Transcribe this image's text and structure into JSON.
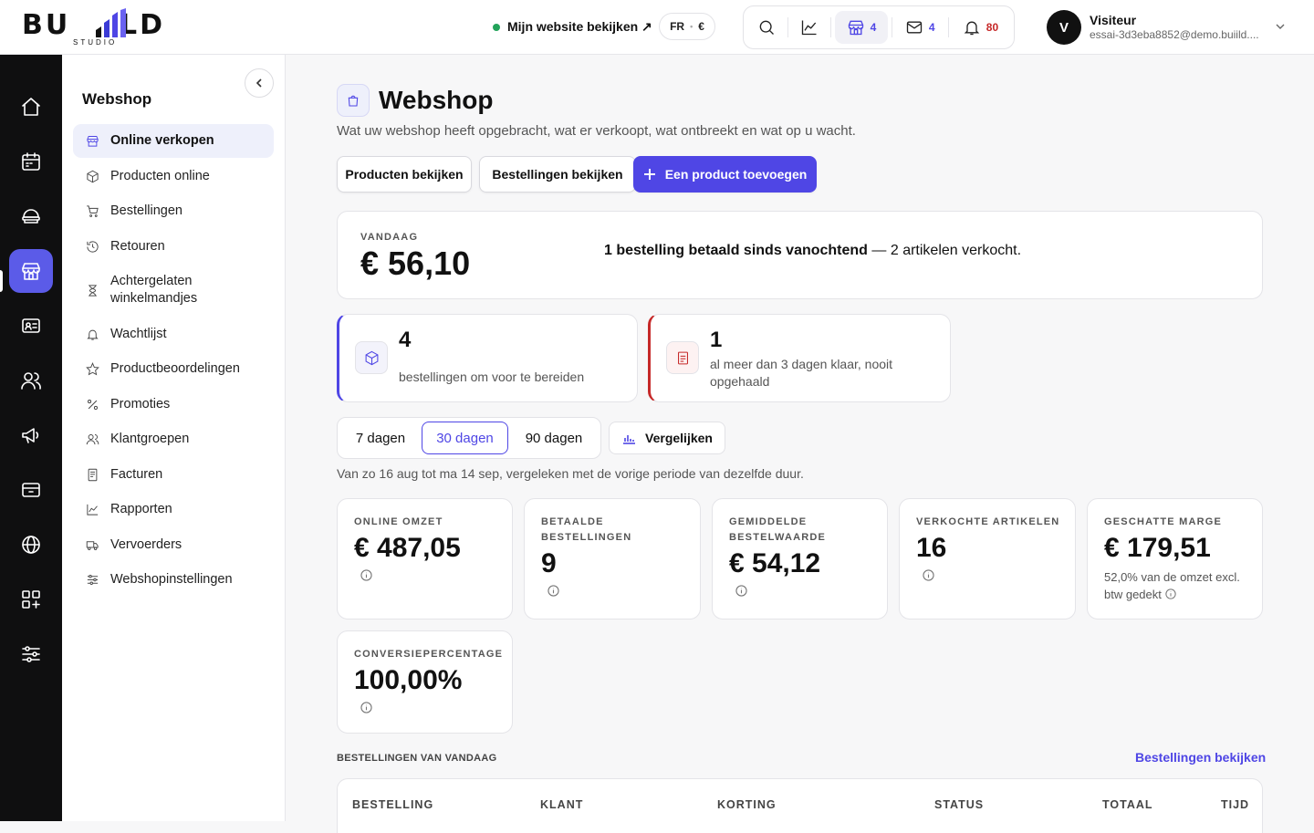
{
  "topbar": {
    "logo_text": "BUILD",
    "logo_sub": "STUDIO",
    "view_site_label": "Mijn website bekijken ↗",
    "language": "FR",
    "currency": "€",
    "badges": {
      "store": "4",
      "mail": "4",
      "notifications": "80"
    },
    "user": {
      "initial": "V",
      "name": "Visiteur",
      "email": "essai-3d3eba8852@demo.buiild...."
    }
  },
  "rail": {
    "icons": [
      "home-icon",
      "calendar-icon",
      "catering-icon",
      "store-icon",
      "id-card-icon",
      "users-icon",
      "megaphone-icon",
      "payment-icon",
      "globe-icon",
      "apps-icon",
      "settings-sliders-icon"
    ],
    "active_index": 3
  },
  "sidebar": {
    "title": "Webshop",
    "items": [
      {
        "label": "Online verkopen",
        "icon": "store-icon",
        "active": true
      },
      {
        "label": "Producten online",
        "icon": "box-icon"
      },
      {
        "label": "Bestellingen",
        "icon": "cart-icon"
      },
      {
        "label": "Retouren",
        "icon": "history-icon"
      },
      {
        "label": "Achtergelaten winkelmandjes",
        "icon": "hourglass-icon"
      },
      {
        "label": "Wachtlijst",
        "icon": "bell-icon"
      },
      {
        "label": "Productbeoordelingen",
        "icon": "star-icon"
      },
      {
        "label": "Promoties",
        "icon": "percent-icon"
      },
      {
        "label": "Klantgroepen",
        "icon": "users-icon"
      },
      {
        "label": "Facturen",
        "icon": "invoice-icon"
      },
      {
        "label": "Rapporten",
        "icon": "chart-line-icon"
      },
      {
        "label": "Vervoerders",
        "icon": "truck-icon"
      },
      {
        "label": "Webshopinstellingen",
        "icon": "sliders-icon"
      }
    ]
  },
  "main": {
    "title": "Webshop",
    "subtitle": "Wat uw webshop heeft opgebracht, wat er verkoopt, wat ontbreekt en wat op u wacht.",
    "buttons": {
      "view_products": "Producten bekijken",
      "view_orders": "Bestellingen bekijken",
      "add_product": "Een product toevoegen"
    },
    "today": {
      "label": "VANDAAG",
      "value": "€ 56,10",
      "message_bold": "1 bestelling betaald sinds vanochtend",
      "message_rest": " — 2 artikelen verkocht."
    },
    "alerts": [
      {
        "number": "4",
        "text": "bestellingen om voor te bereiden",
        "color": "#4f46e5"
      },
      {
        "number": "1",
        "text": "al meer dan 3 dagen klaar, nooit opgehaald",
        "color": "#c62828"
      }
    ],
    "periods": {
      "options": [
        "7 dagen",
        "30 dagen",
        "90 dagen"
      ],
      "selected": "30 dagen"
    },
    "compare_label": "Vergelijken",
    "period_text": "Van zo 16 aug tot ma 14 sep, vergeleken met de vorige periode van dezelfde duur.",
    "kpis": [
      {
        "label": "ONLINE OMZET",
        "value": "€ 487,05"
      },
      {
        "label": "BETAALDE BESTELLINGEN",
        "value": "9"
      },
      {
        "label": "GEMIDDELDE BESTELWAARDE",
        "value": "€ 54,12"
      },
      {
        "label": "VERKOCHTE ARTIKELEN",
        "value": "16"
      },
      {
        "label": "GESCHATTE MARGE",
        "value": "€ 179,51",
        "note": "52,0% van de omzet excl. btw gedekt"
      },
      {
        "label": "CONVERSIEPERCENTAGE",
        "value": "100,00%"
      }
    ],
    "orders_section": {
      "title": "BESTELLINGEN VAN VANDAAG",
      "link": "Bestellingen bekijken",
      "columns": [
        "BESTELLING",
        "KLANT",
        "KORTING",
        "STATUS",
        "TOTAAL",
        "TIJD"
      ]
    }
  },
  "colors": {
    "accent": "#4f46e5",
    "alert_red": "#c62828",
    "online_green": "#22a35a",
    "rail_bg": "#0f0f10"
  }
}
